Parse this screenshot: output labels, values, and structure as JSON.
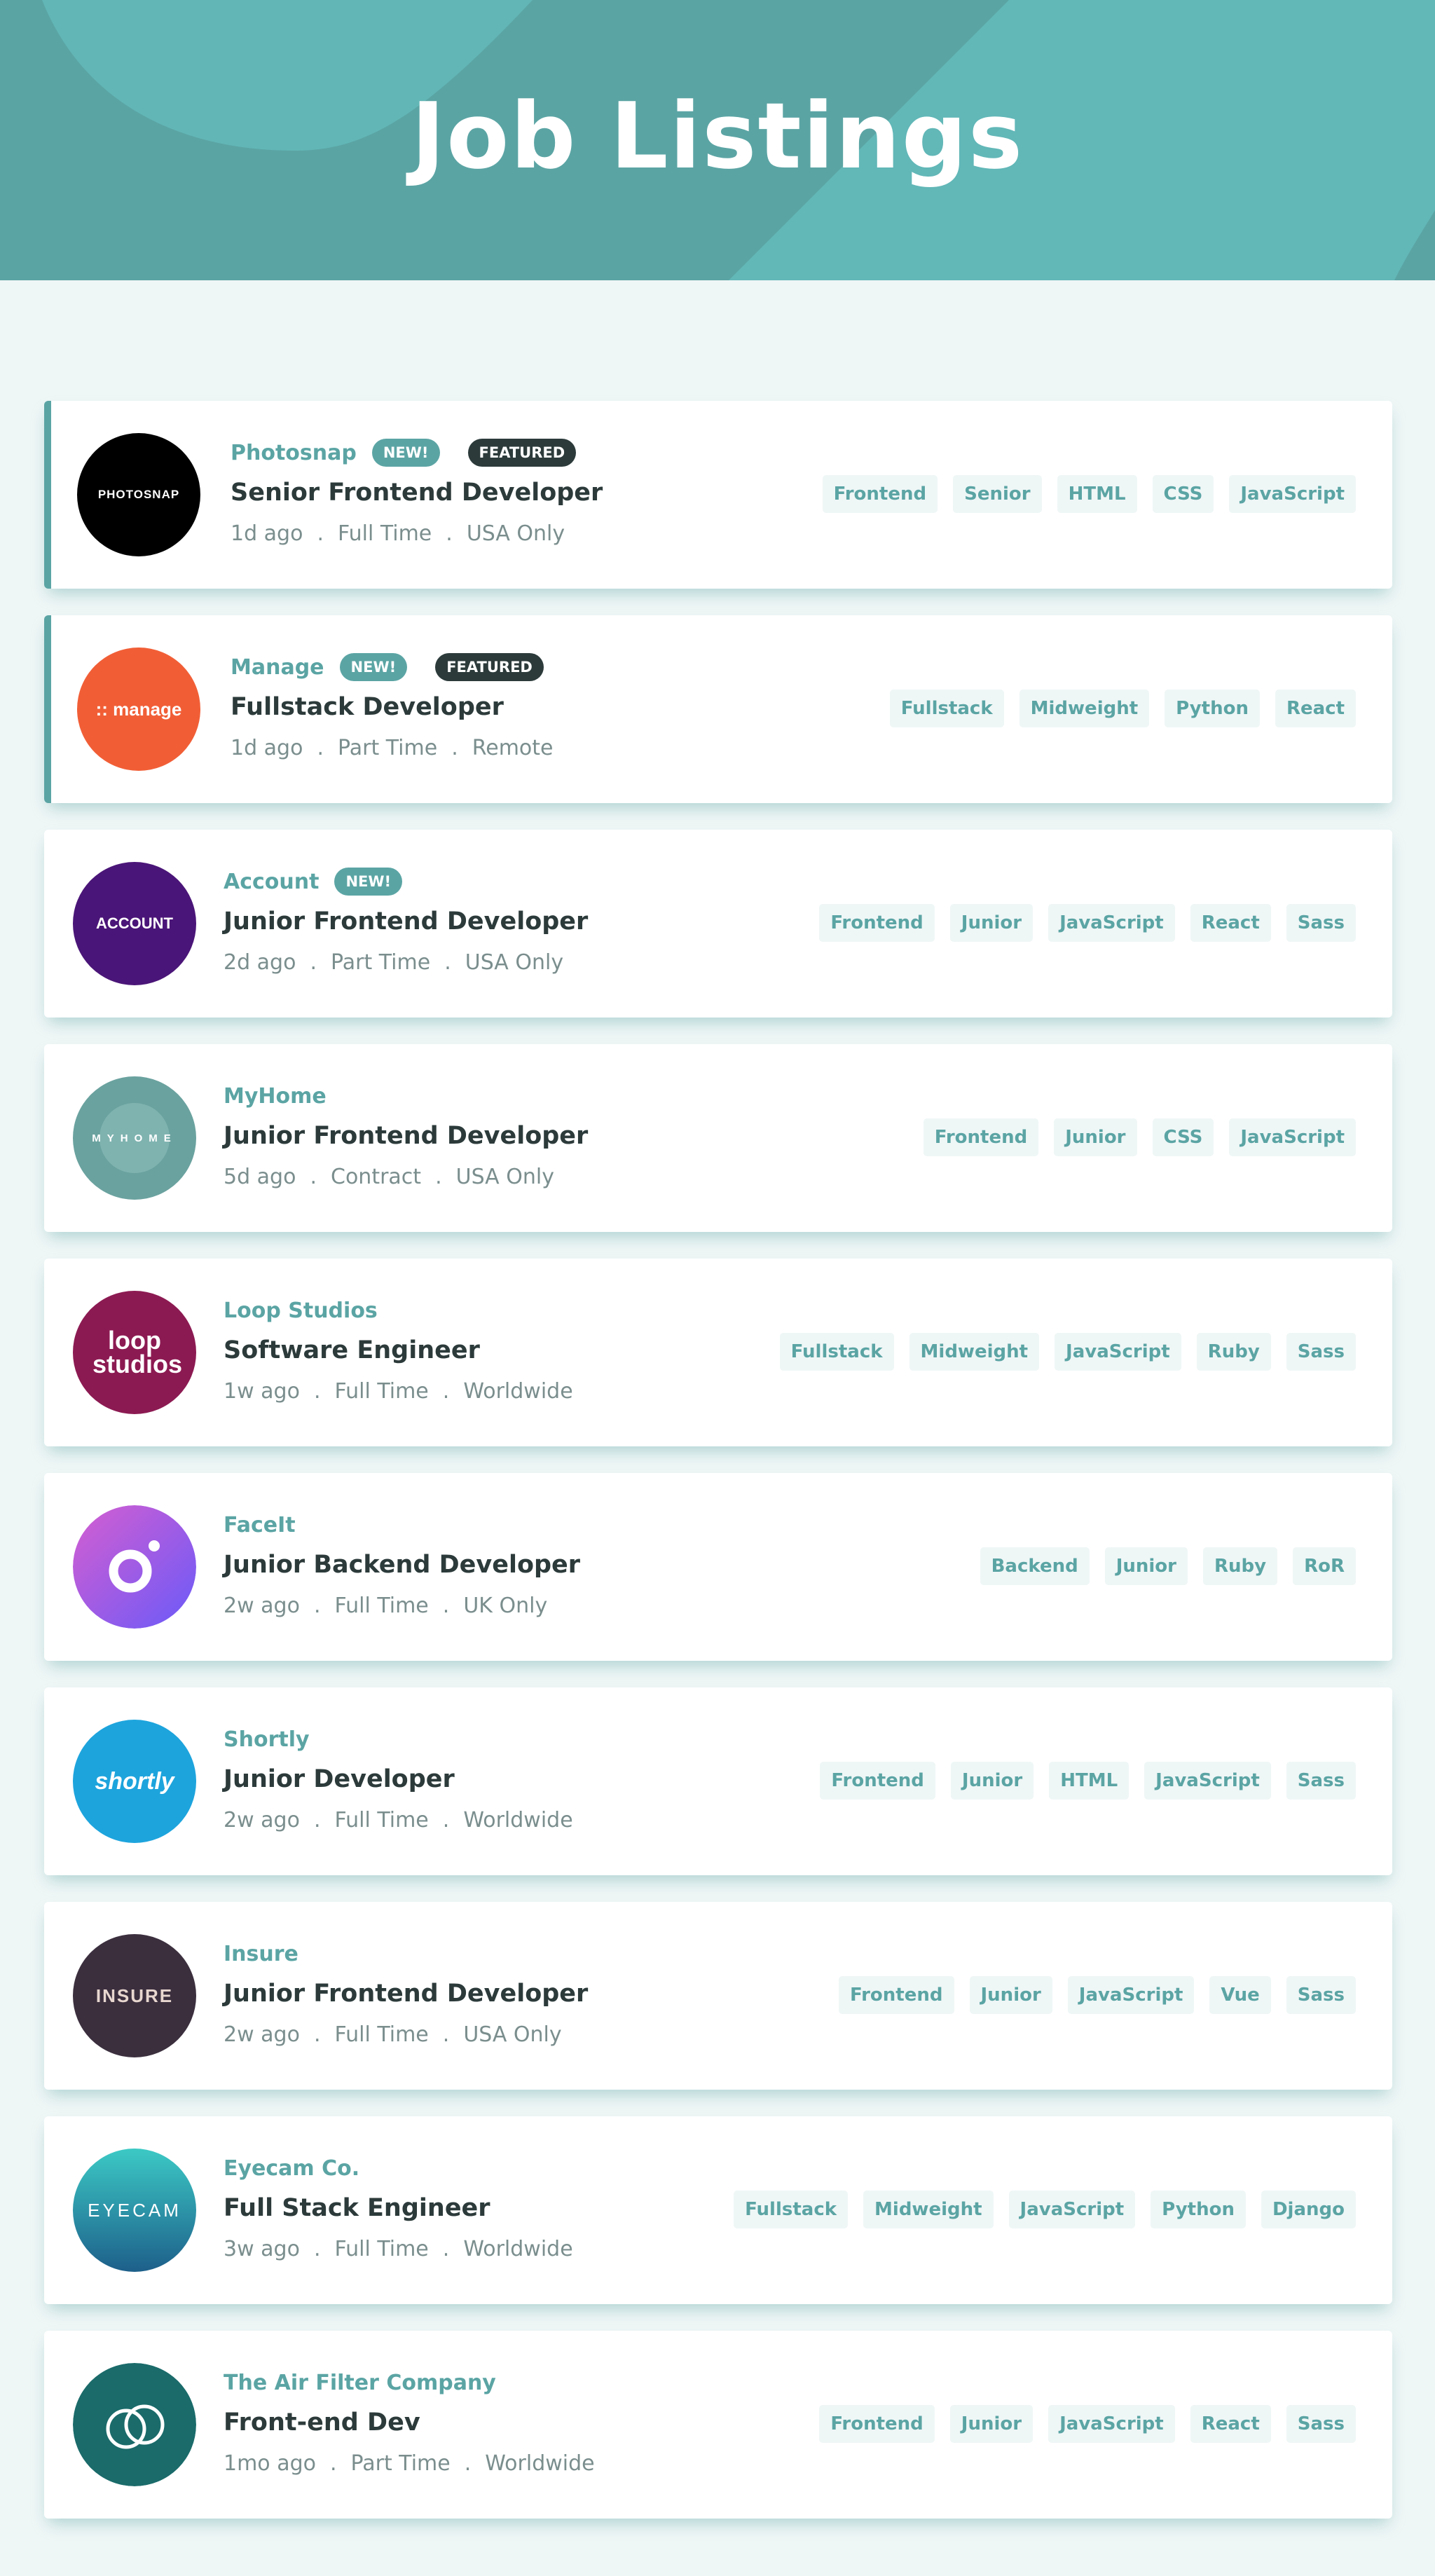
{
  "header": {
    "title": "Job Listings"
  },
  "colors": {
    "primary": "#5ba4a4",
    "background": "#eff6f6",
    "dark": "#2c3a3a",
    "muted": "#7b8e8e"
  },
  "jobs": [
    {
      "company": "Photosnap",
      "logo_text": "PHOTOSNAP",
      "logo_color": "#000000",
      "new": "NEW!",
      "featured": "FEATURED",
      "position": "Senior Frontend Developer",
      "posted": "1d ago",
      "contract": "Full Time",
      "location": "USA Only",
      "tags": [
        "Frontend",
        "Senior",
        "HTML",
        "CSS",
        "JavaScript"
      ]
    },
    {
      "company": "Manage",
      "logo_text": ":: manage",
      "logo_color": "#f15e36",
      "new": "NEW!",
      "featured": "FEATURED",
      "position": "Fullstack Developer",
      "posted": "1d ago",
      "contract": "Part Time",
      "location": "Remote",
      "tags": [
        "Fullstack",
        "Midweight",
        "Python",
        "React"
      ]
    },
    {
      "company": "Account",
      "logo_text": "ACCOUNT",
      "logo_color": "#4a1578",
      "new": "NEW!",
      "featured": "",
      "position": "Junior Frontend Developer",
      "posted": "2d ago",
      "contract": "Part Time",
      "location": "USA Only",
      "tags": [
        "Frontend",
        "Junior",
        "JavaScript",
        "React",
        "Sass"
      ]
    },
    {
      "company": "MyHome",
      "logo_text": "MYHOME",
      "logo_color": "#6aa29f",
      "new": "",
      "featured": "",
      "position": "Junior Frontend Developer",
      "posted": "5d ago",
      "contract": "Contract",
      "location": "USA Only",
      "tags": [
        "Frontend",
        "Junior",
        "CSS",
        "JavaScript"
      ]
    },
    {
      "company": "Loop Studios",
      "logo_text": "loop studios",
      "logo_color": "#8c1a52",
      "new": "",
      "featured": "",
      "position": "Software Engineer",
      "posted": "1w ago",
      "contract": "Full Time",
      "location": "Worldwide",
      "tags": [
        "Fullstack",
        "Midweight",
        "JavaScript",
        "Ruby",
        "Sass"
      ]
    },
    {
      "company": "FaceIt",
      "logo_text": "",
      "logo_color": "#9b51e0",
      "new": "",
      "featured": "",
      "position": "Junior Backend Developer",
      "posted": "2w ago",
      "contract": "Full Time",
      "location": "UK Only",
      "tags": [
        "Backend",
        "Junior",
        "Ruby",
        "RoR"
      ]
    },
    {
      "company": "Shortly",
      "logo_text": "shortly",
      "logo_color": "#1da4dd",
      "new": "",
      "featured": "",
      "position": "Junior Developer",
      "posted": "2w ago",
      "contract": "Full Time",
      "location": "Worldwide",
      "tags": [
        "Frontend",
        "Junior",
        "HTML",
        "JavaScript",
        "Sass"
      ]
    },
    {
      "company": "Insure",
      "logo_text": "INSURE",
      "logo_color": "#3b2f3e",
      "new": "",
      "featured": "",
      "position": "Junior Frontend Developer",
      "posted": "2w ago",
      "contract": "Full Time",
      "location": "USA Only",
      "tags": [
        "Frontend",
        "Junior",
        "JavaScript",
        "Vue",
        "Sass"
      ]
    },
    {
      "company": "Eyecam Co.",
      "logo_text": "EYECAM",
      "logo_color": "#1d7b94",
      "new": "",
      "featured": "",
      "position": "Full Stack Engineer",
      "posted": "3w ago",
      "contract": "Full Time",
      "location": "Worldwide",
      "tags": [
        "Fullstack",
        "Midweight",
        "JavaScript",
        "Python",
        "Django"
      ]
    },
    {
      "company": "The Air Filter Company",
      "logo_text": "",
      "logo_color": "#1a6b6a",
      "new": "",
      "featured": "",
      "position": "Front-end Dev",
      "posted": "1mo ago",
      "contract": "Part Time",
      "location": "Worldwide",
      "tags": [
        "Frontend",
        "Junior",
        "JavaScript",
        "React",
        "Sass"
      ]
    }
  ]
}
